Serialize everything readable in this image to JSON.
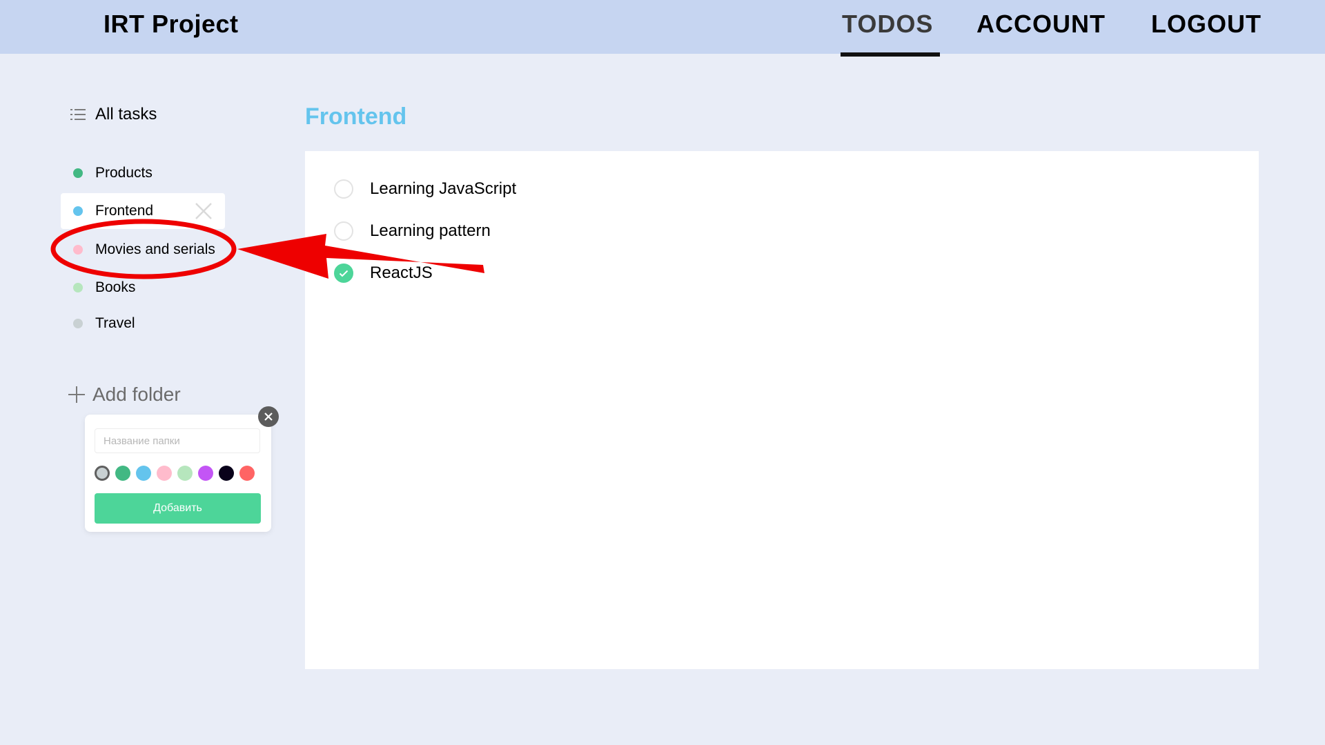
{
  "header": {
    "brand": "IRT Project",
    "nav": [
      "TODOS",
      "ACCOUNT",
      "LOGOUT"
    ],
    "active_nav": "TODOS"
  },
  "sidebar": {
    "all_tasks_label": "All tasks",
    "folders": [
      {
        "label": "Products",
        "color": "#42b883",
        "active": false
      },
      {
        "label": "Frontend",
        "color": "#64c4ed",
        "active": true
      },
      {
        "label": "Movies and serials",
        "color": "#ffbbcc",
        "active": false
      },
      {
        "label": "Books",
        "color": "#b6e6bd",
        "active": false
      },
      {
        "label": "Travel",
        "color": "#c9d1d3",
        "active": false
      }
    ],
    "add_folder_label": "Add folder"
  },
  "add_folder_popup": {
    "input_placeholder": "Название папки",
    "input_value": "",
    "colors": [
      "#c9d1d3",
      "#42b883",
      "#64c4ed",
      "#ffbbcc",
      "#b6e6bd",
      "#c355f5",
      "#09011a",
      "#ff6464"
    ],
    "selected_color": "#c9d1d3",
    "submit_label": "Добавить"
  },
  "main": {
    "title": "Frontend",
    "title_color": "#64c4ed",
    "tasks": [
      {
        "text": "Learning JavaScript",
        "completed": false
      },
      {
        "text": "Learning pattern",
        "completed": false
      },
      {
        "text": "ReactJS",
        "completed": true
      }
    ]
  },
  "annotation": {
    "color": "#ee0000",
    "target": "Movies and serials"
  }
}
